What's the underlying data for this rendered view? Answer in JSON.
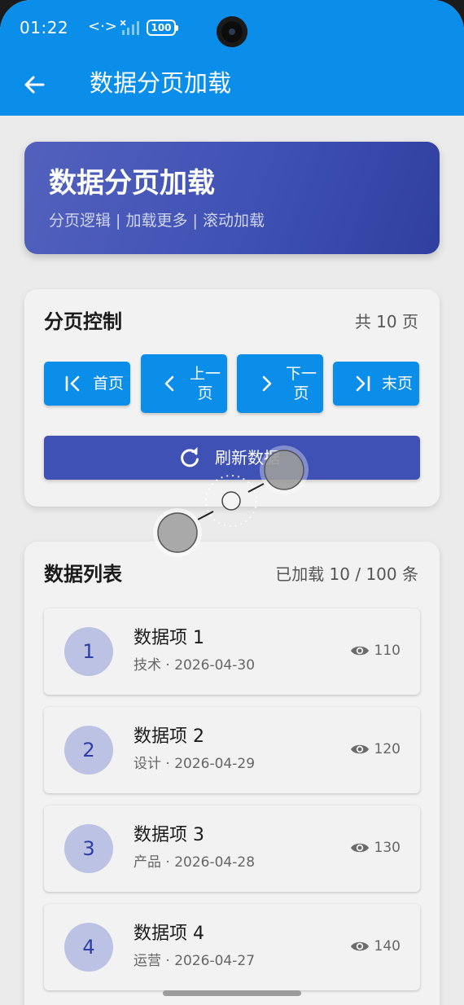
{
  "status": {
    "time": "01:22",
    "battery": "100"
  },
  "appbar": {
    "title": "数据分页加载"
  },
  "hero": {
    "title": "数据分页加载",
    "subtitle": "分页逻辑 | 加载更多 | 滚动加载"
  },
  "pager": {
    "title": "分页控制",
    "total_pages": "共 10 页",
    "first": "首页",
    "prev": "上一页",
    "next": "下一页",
    "last": "末页",
    "refresh": "刷新数据"
  },
  "list": {
    "title": "数据列表",
    "loaded": "已加载 10 / 100 条",
    "items": [
      {
        "num": "1",
        "name": "数据项 1",
        "sub": "技术 · 2026-04-30",
        "views": "110"
      },
      {
        "num": "2",
        "name": "数据项 2",
        "sub": "设计 · 2026-04-29",
        "views": "120"
      },
      {
        "num": "3",
        "name": "数据项 3",
        "sub": "产品 · 2026-04-28",
        "views": "130"
      },
      {
        "num": "4",
        "name": "数据项 4",
        "sub": "运营 · 2026-04-27",
        "views": "140"
      }
    ]
  },
  "colors": {
    "primary": "#0a8eea",
    "indigo": "#3f51b5",
    "avatar_bg": "#bcc2e4"
  },
  "icons": [
    "back-arrow-icon",
    "first-page-icon",
    "chevron-left-icon",
    "chevron-right-icon",
    "last-page-icon",
    "refresh-icon",
    "eye-icon"
  ]
}
